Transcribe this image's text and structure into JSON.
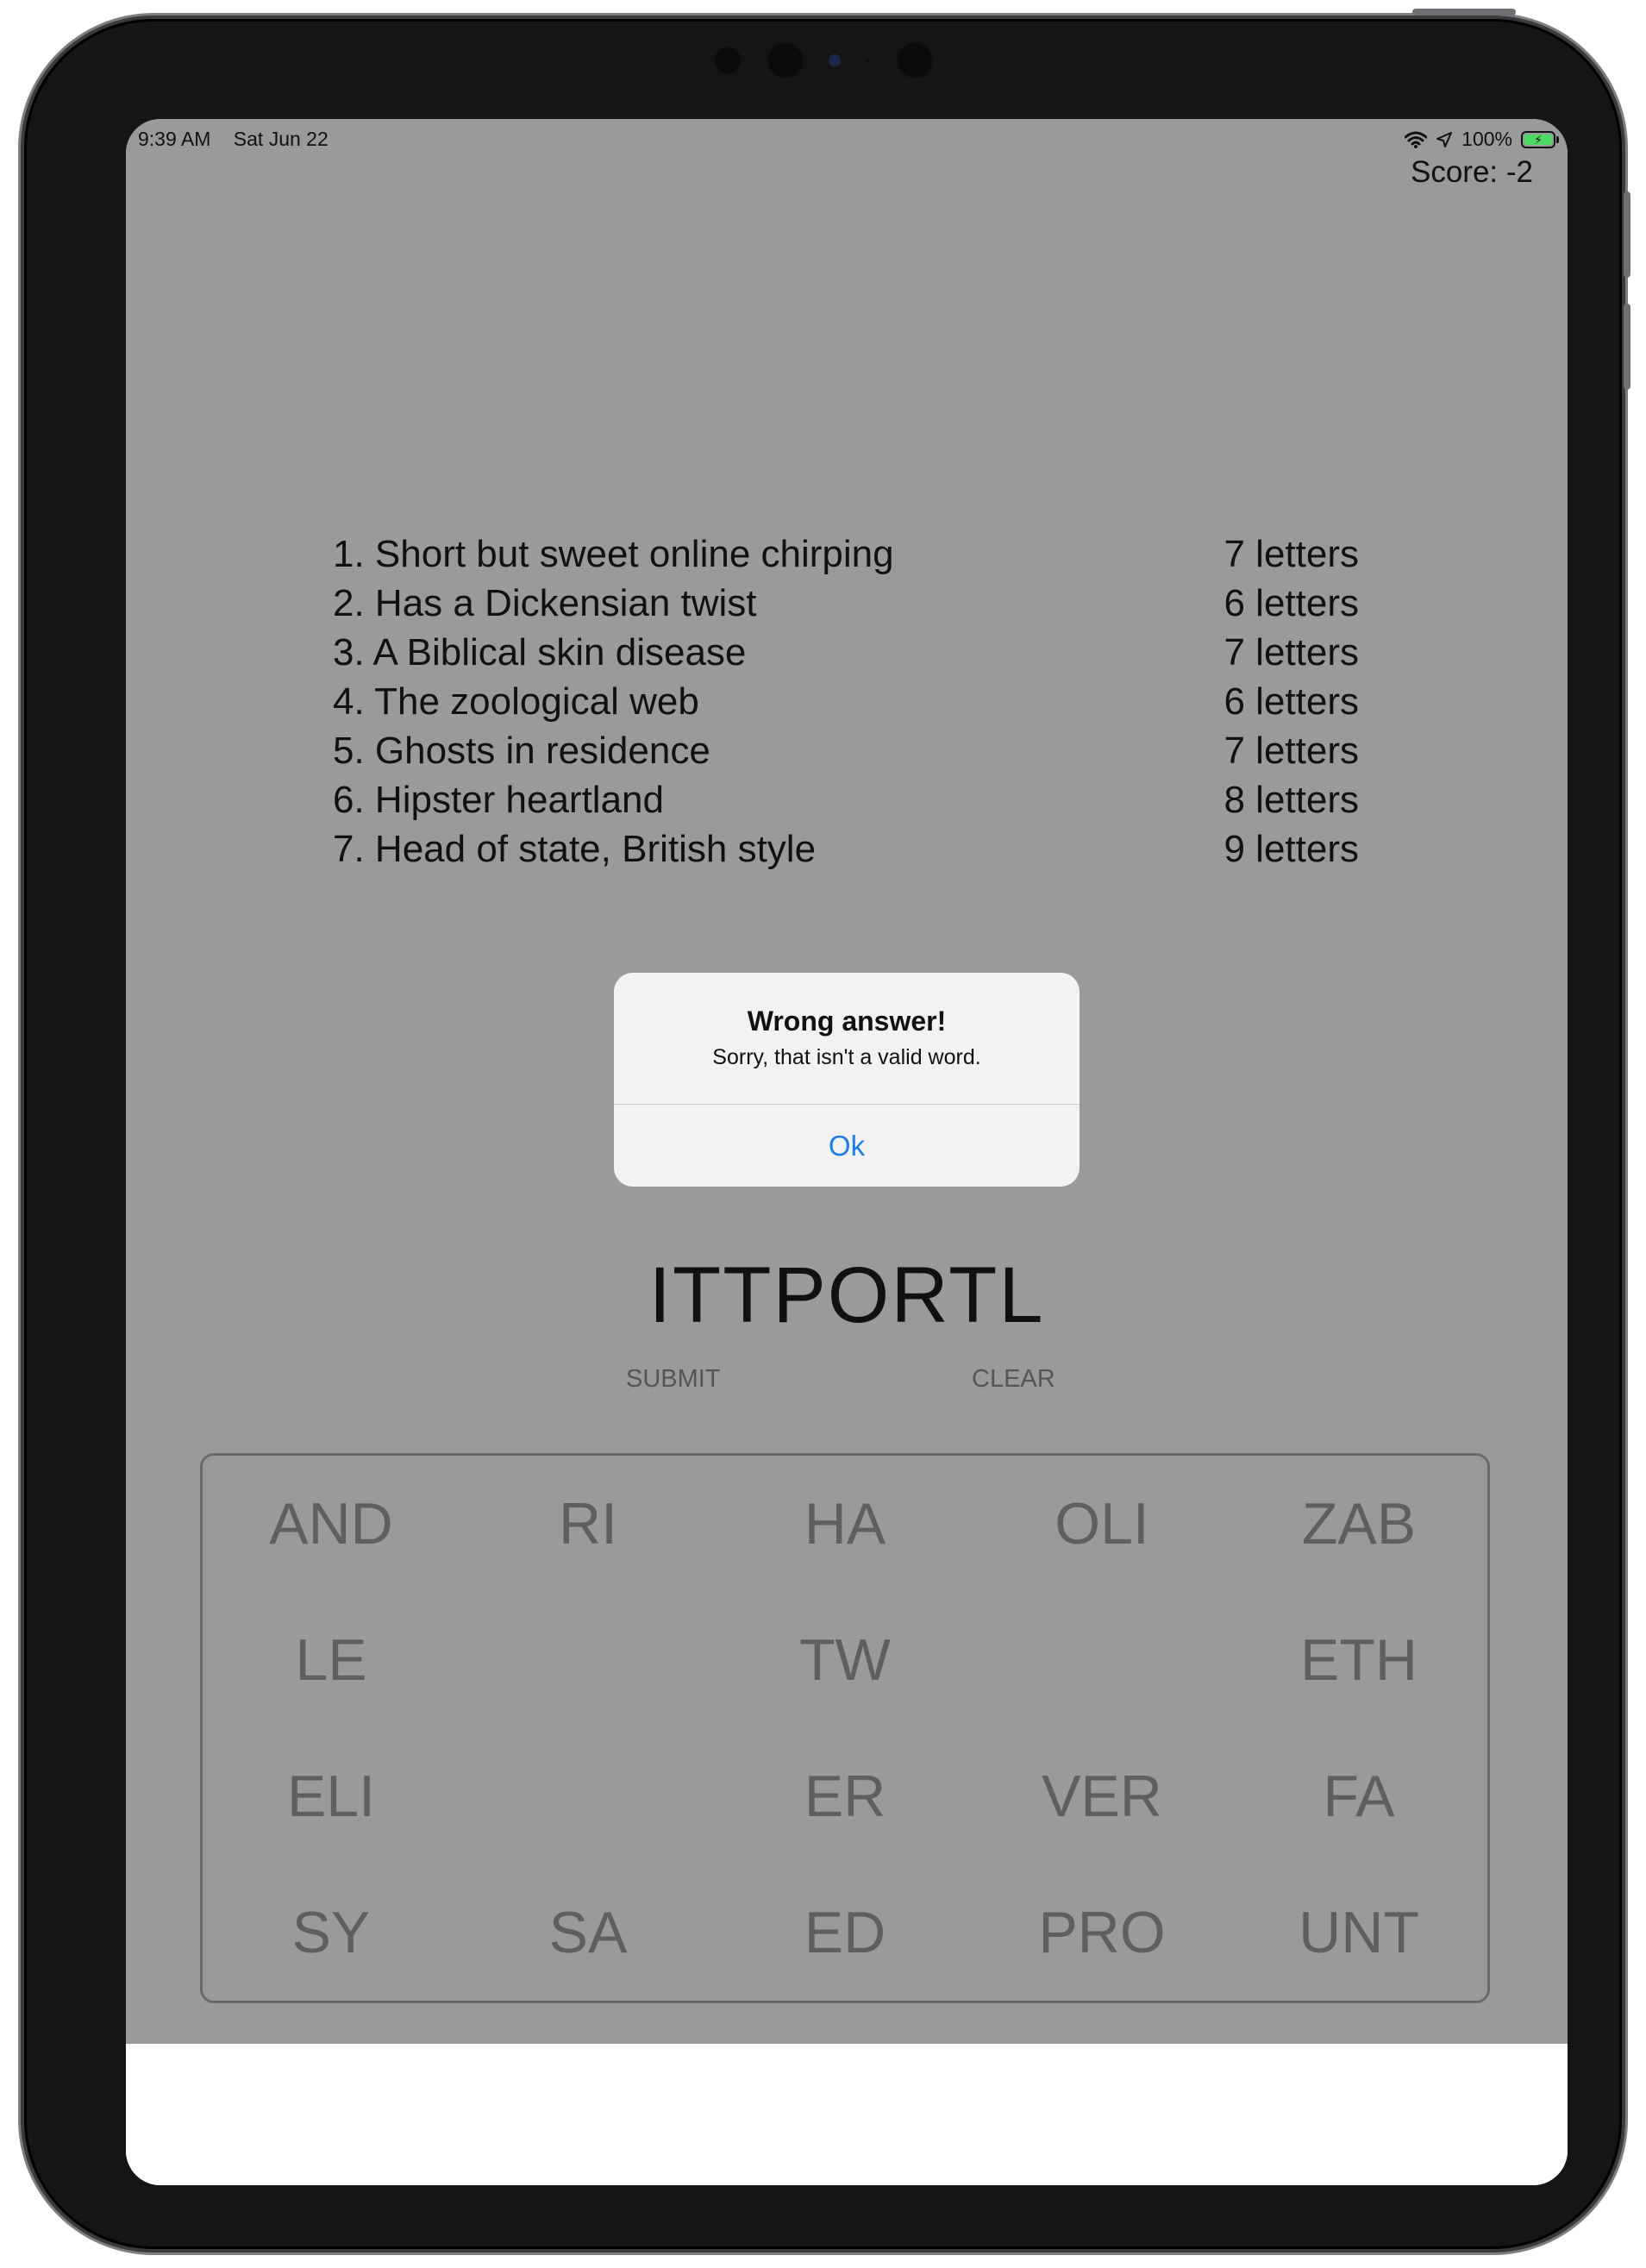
{
  "status_bar": {
    "time": "9:39 AM",
    "date": "Sat Jun 22",
    "battery": "100%"
  },
  "score": "Score: -2",
  "clues": [
    {
      "text": "1. Short but sweet online chirping",
      "length": "7 letters"
    },
    {
      "text": "2. Has a Dickensian twist",
      "length": "6 letters"
    },
    {
      "text": "3. A Biblical skin disease",
      "length": "7 letters"
    },
    {
      "text": "4. The zoological web",
      "length": "6 letters"
    },
    {
      "text": "5. Ghosts in residence",
      "length": "7 letters"
    },
    {
      "text": "6. Hipster heartland",
      "length": "8 letters"
    },
    {
      "text": "7. Head of state, British style",
      "length": "9 letters"
    }
  ],
  "alert": {
    "title": "Wrong answer!",
    "message": "Sorry, that isn't a valid word.",
    "ok_label": "Ok"
  },
  "current_word": "ITTPORTL",
  "actions": {
    "submit_label": "SUBMIT",
    "clear_label": "CLEAR"
  },
  "tiles": [
    [
      "AND",
      "RI",
      "HA",
      "OLI",
      "ZAB"
    ],
    [
      "LE",
      "",
      "TW",
      "",
      "ETH"
    ],
    [
      "ELI",
      "",
      "ER",
      "VER",
      "FA"
    ],
    [
      "SY",
      "SA",
      "ED",
      "PRO",
      "UNT"
    ]
  ],
  "colors": {
    "dim_background": "#9a9a9a",
    "alert_background": "#f2f2f2",
    "alert_button": "#1a7ee6",
    "tile_text": "#5f5f5f",
    "battery_fill": "#4cd964"
  }
}
